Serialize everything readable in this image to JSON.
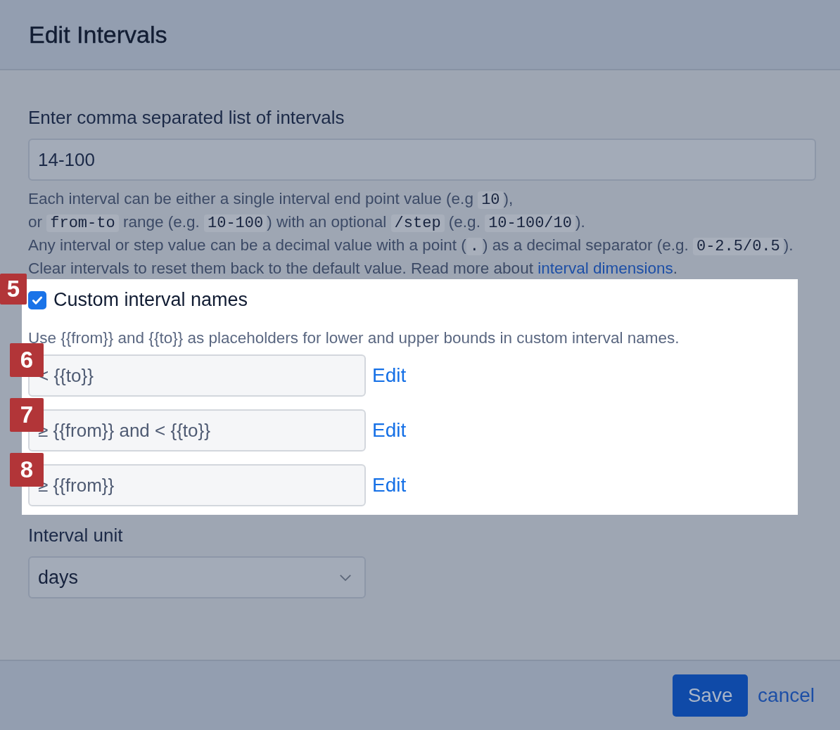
{
  "dialog": {
    "title": "Edit Intervals"
  },
  "intervals": {
    "label": "Enter comma separated list of intervals",
    "value": "14-100",
    "help": [
      [
        {
          "kind": "text",
          "text": "Each interval can be either a single interval end point value (e.g "
        },
        {
          "kind": "code",
          "text": "10"
        },
        {
          "kind": "text",
          "text": "),"
        }
      ],
      [
        {
          "kind": "text",
          "text": "or "
        },
        {
          "kind": "code",
          "text": "from-to"
        },
        {
          "kind": "text",
          "text": " range (e.g. "
        },
        {
          "kind": "code",
          "text": "10-100"
        },
        {
          "kind": "text",
          "text": ") with an optional "
        },
        {
          "kind": "code",
          "text": "/step"
        },
        {
          "kind": "text",
          "text": " (e.g. "
        },
        {
          "kind": "code",
          "text": "10-100/10"
        },
        {
          "kind": "text",
          "text": ")."
        }
      ],
      [
        {
          "kind": "text",
          "text": "Any interval or step value can be a decimal value with a point ("
        },
        {
          "kind": "code",
          "text": "."
        },
        {
          "kind": "text",
          "text": ") as a decimal separator (e.g. "
        },
        {
          "kind": "code",
          "text": "0-2.5/0.5"
        },
        {
          "kind": "text",
          "text": ")."
        }
      ],
      [
        {
          "kind": "text",
          "text": "Clear intervals to reset them back to the default value. Read more about "
        },
        {
          "kind": "link",
          "text": "interval dimensions"
        },
        {
          "kind": "text",
          "text": "."
        }
      ]
    ]
  },
  "custom_names": {
    "highlighted": true,
    "callout": "5",
    "label": "Custom interval names",
    "checked": true,
    "hint": "Use {{from}} and {{to}} as placeholders for lower and upper bounds in custom interval names.",
    "rows": [
      {
        "callout": "6",
        "value": "< {{to}}",
        "action": "Edit"
      },
      {
        "callout": "7",
        "value": "≥ {{from}} and < {{to}}",
        "action": "Edit"
      },
      {
        "callout": "8",
        "value": "≥ {{from}}",
        "action": "Edit"
      }
    ]
  },
  "unit": {
    "label": "Interval unit",
    "value": "days"
  },
  "buttons": {
    "save": "Save",
    "cancel": "cancel"
  }
}
